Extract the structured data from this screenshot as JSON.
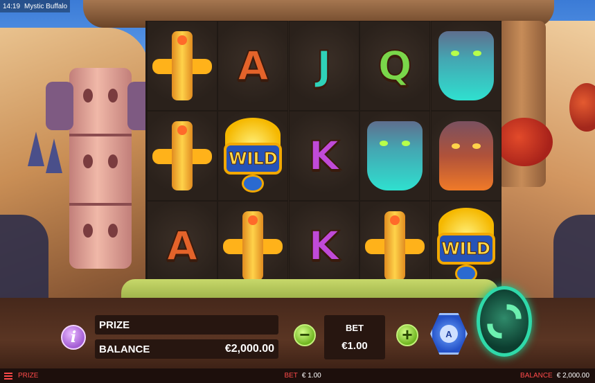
{
  "status_bar": {
    "time": "14:19",
    "title": "Mystic Buffalo"
  },
  "reels": {
    "grid": [
      [
        "totem",
        "totem",
        "A"
      ],
      [
        "A",
        "wild",
        "totem"
      ],
      [
        "J",
        "K",
        "K"
      ],
      [
        "Q",
        "wolf",
        "totem"
      ],
      [
        "wolf",
        "bear",
        "wild"
      ]
    ],
    "letter_colors": {
      "A": "#e4632a",
      "J": "#2fd1b8",
      "K": "#c04ad8",
      "Q": "#7ad64a"
    },
    "wild_label": "WILD"
  },
  "panel": {
    "prize_label": "PRIZE",
    "prize_value": "",
    "balance_label": "BALANCE",
    "balance_value": "€2,000.00",
    "bet_label": "BET",
    "bet_value": "€1.00",
    "minus_label": "−",
    "plus_label": "+",
    "auto_label": "A",
    "info_label": "i"
  },
  "bottom_bar": {
    "prize_label": "PRIZE",
    "bet_label": "BET",
    "bet_value": "€ 1.00",
    "balance_label": "BALANCE",
    "balance_value": "€ 2,000.00"
  },
  "colors": {
    "accent_green": "#6fb520",
    "spin_ring": "#2fd9a9",
    "bottom_text": "#ff4a4a"
  }
}
